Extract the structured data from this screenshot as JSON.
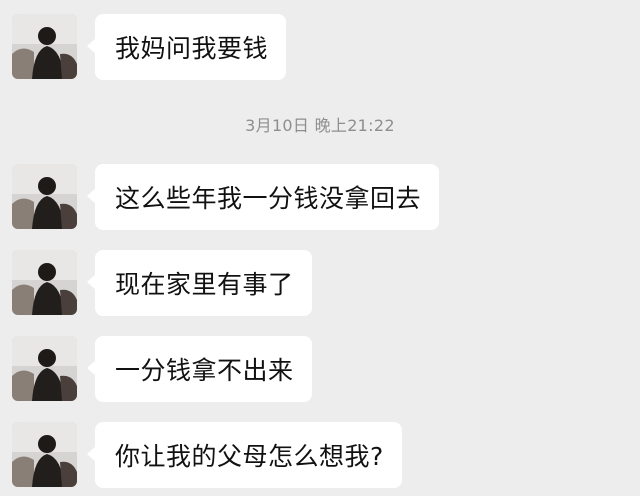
{
  "conversation": {
    "timestamp": "3月10日 晚上21:22",
    "messages": [
      {
        "text": "我妈问我要钱",
        "avatar": "avatar-photo"
      },
      {
        "text": "这么些年我一分钱没拿回去",
        "avatar": "avatar-photo"
      },
      {
        "text": "现在家里有事了",
        "avatar": "avatar-photo"
      },
      {
        "text": "一分钱拿不出来",
        "avatar": "avatar-photo"
      },
      {
        "text": "你让我的父母怎么想我?",
        "avatar": "avatar-photo"
      }
    ]
  },
  "colors": {
    "background": "#ededed",
    "bubble": "#ffffff",
    "timestamp_text": "#8e8e8e",
    "message_text": "#111111"
  }
}
